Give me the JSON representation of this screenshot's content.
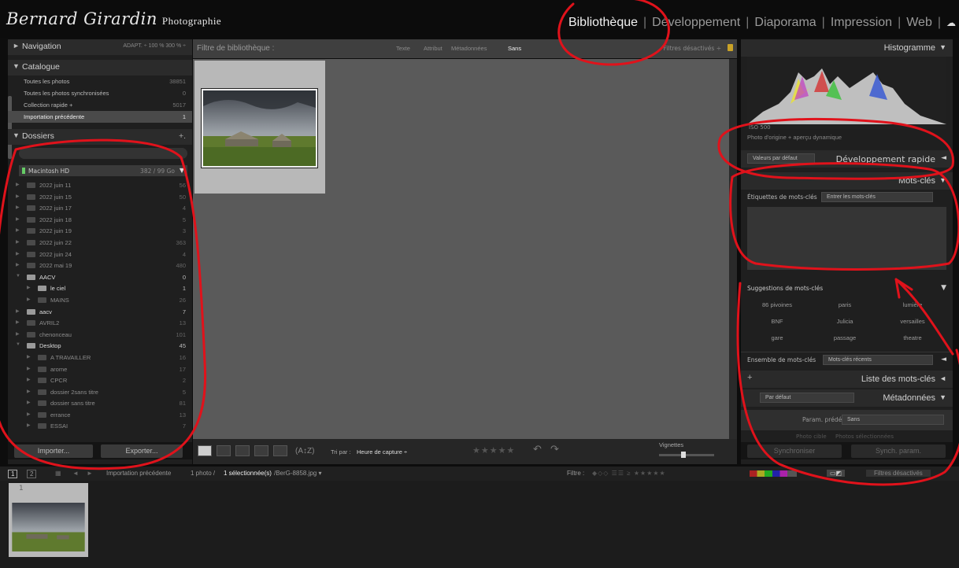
{
  "brand": {
    "signature": "Bernard Girardin",
    "subtitle": "Photographie"
  },
  "modules": [
    {
      "label": "Bibliothèque",
      "active": true
    },
    {
      "label": "Développement",
      "active": false
    },
    {
      "label": "Diaporama",
      "active": false
    },
    {
      "label": "Impression",
      "active": false
    },
    {
      "label": "Web",
      "active": false
    }
  ],
  "navigator": {
    "title": "Navigation",
    "zoom": "ADAPT. ÷   100 %   300 % ÷"
  },
  "catalog": {
    "title": "Catalogue",
    "items": [
      {
        "label": "Toutes les photos",
        "count": "38851"
      },
      {
        "label": "Toutes les photos synchronisées",
        "count": "0"
      },
      {
        "label": "Collection rapide +",
        "count": "5017"
      },
      {
        "label": "Importation précédente",
        "count": "1",
        "selected": true
      }
    ]
  },
  "folders": {
    "title": "Dossiers",
    "add": "+.",
    "volume": {
      "label": "Macintosh HD",
      "size": "382 / 99 Go"
    },
    "items": [
      {
        "label": "2022 juin 11",
        "count": "56",
        "level": 0,
        "bright": false,
        "open": false
      },
      {
        "label": "2022 juin 15",
        "count": "50",
        "level": 0,
        "bright": false,
        "open": false
      },
      {
        "label": "2022 juin 17",
        "count": "4",
        "level": 0,
        "bright": false,
        "open": false
      },
      {
        "label": "2022 juin 18",
        "count": "5",
        "level": 0,
        "bright": false,
        "open": false
      },
      {
        "label": "2022 juin 19",
        "count": "3",
        "level": 0,
        "bright": false,
        "open": false
      },
      {
        "label": "2022 juin 22",
        "count": "363",
        "level": 0,
        "bright": false,
        "open": false
      },
      {
        "label": "2022 juin 24",
        "count": "4",
        "level": 0,
        "bright": false,
        "open": false
      },
      {
        "label": "2022 mai 19",
        "count": "480",
        "level": 0,
        "bright": false,
        "open": false
      },
      {
        "label": "AACV",
        "count": "0",
        "level": 0,
        "bright": true,
        "open": true
      },
      {
        "label": "le ciel",
        "count": "1",
        "level": 1,
        "bright": true,
        "open": false
      },
      {
        "label": "MAINS",
        "count": "26",
        "level": 1,
        "bright": false,
        "open": false
      },
      {
        "label": "aacv",
        "count": "7",
        "level": 0,
        "bright": true,
        "open": false
      },
      {
        "label": "AVRIL2",
        "count": "13",
        "level": 0,
        "bright": false,
        "open": false
      },
      {
        "label": "chenonceau",
        "count": "101",
        "level": 0,
        "bright": false,
        "open": false
      },
      {
        "label": "Desktop",
        "count": "45",
        "level": 0,
        "bright": true,
        "open": true
      },
      {
        "label": "A TRAVAILLER",
        "count": "16",
        "level": 1,
        "bright": false,
        "open": false
      },
      {
        "label": "arome",
        "count": "17",
        "level": 1,
        "bright": false,
        "open": false
      },
      {
        "label": "CPCR",
        "count": "2",
        "level": 1,
        "bright": false,
        "open": false
      },
      {
        "label": "dossier 2sans titre",
        "count": "5",
        "level": 1,
        "bright": false,
        "open": false
      },
      {
        "label": "dossier sans titre",
        "count": "81",
        "level": 1,
        "bright": false,
        "open": false
      },
      {
        "label": "errance",
        "count": "13",
        "level": 1,
        "bright": false,
        "open": false
      },
      {
        "label": "ESSAI",
        "count": "7",
        "level": 1,
        "bright": false,
        "open": false
      }
    ]
  },
  "left_buttons": {
    "import": "Importer...",
    "export": "Exporter..."
  },
  "filter_bar": {
    "title": "Filtre de bibliothèque :",
    "options": [
      "Texte",
      "Attribut",
      "Métadonnées",
      "Sans"
    ],
    "status": "Filtres désactivés ÷"
  },
  "toolbar": {
    "sort_label": "Tri par :",
    "sort_value": "Heure de capture ÷",
    "thumbs_label": "Vignettes"
  },
  "histogram": {
    "title": "Histogramme",
    "iso": "ISO 500",
    "preview": "Photo d'origine + aperçu dynamique"
  },
  "quick_develop": {
    "preset": "Valeurs par défaut",
    "title": "Développement rapide"
  },
  "keywording": {
    "title": "Mots-clés",
    "tags_label": "Étiquettes de mots-clés",
    "tags_value": "Entrer les mots-clés",
    "suggestions_title": "Suggestions de mots-clés",
    "suggestions": [
      "86 pivoines",
      "paris",
      "lumière",
      "BNF",
      "Julicia",
      "versailles",
      "gare",
      "passage",
      "theatre"
    ],
    "set_label": "Ensemble de mots-clés",
    "set_value": "Mots-clés récents"
  },
  "keyword_list": {
    "title": "Liste des mots-clés"
  },
  "metadata": {
    "preset": "Par défaut",
    "title": "Métadonnées",
    "preset_label": "Param. prédéf.",
    "preset_value": "Sans",
    "target_photo": "Photo cible",
    "target_selected": "Photos sélectionnées"
  },
  "right_buttons": {
    "sync": "Synchroniser",
    "sync_settings": "Synch. param."
  },
  "filmstrip": {
    "source": "Importation précédente",
    "info_prefix": "1 photo /",
    "selected": "1 sélectionnée(s)",
    "filename": "/BerG-8858.jpg ▾",
    "filter_label": "Filtre :",
    "filter_status": "Filtres désactivés",
    "cell_number": "1"
  },
  "colors": {
    "accent_red": "#e0121b",
    "lock": "#c9a227"
  }
}
